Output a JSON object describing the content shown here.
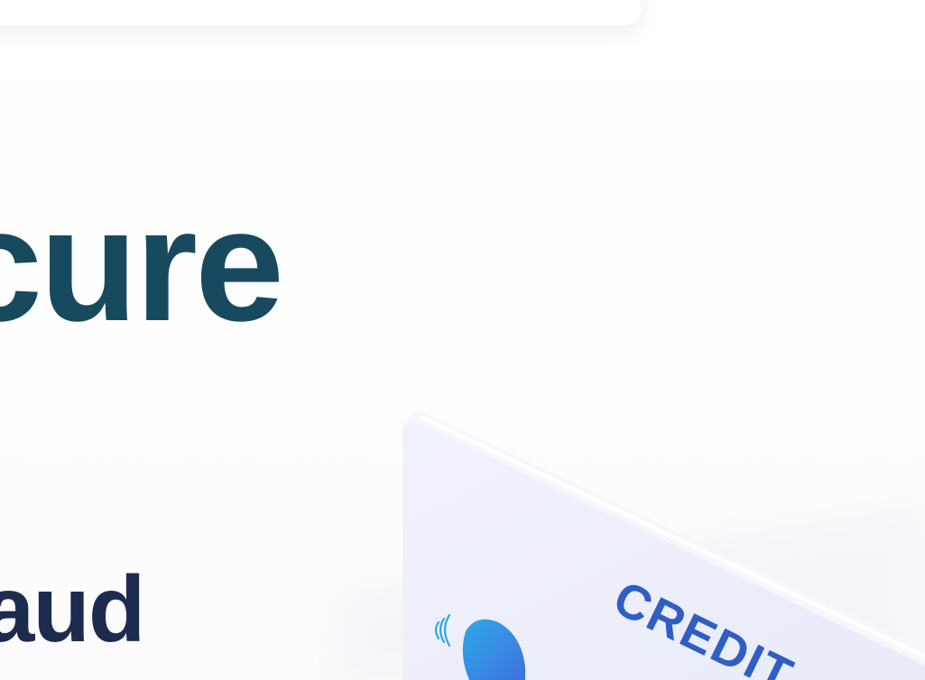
{
  "header": {
    "headline": "cure",
    "subheadline": "raud"
  },
  "card": {
    "label": "CREDIT",
    "icons": [
      "contactless-icon",
      "card-chip-icon"
    ]
  },
  "colors": {
    "headline": "#174a5e",
    "subheadline": "#1d2c4e",
    "card_face": "#eef0fb",
    "card_label": "#2f5ec4",
    "chip_gradient_start": "#2ea8e8",
    "chip_gradient_end": "#3f72e0"
  }
}
